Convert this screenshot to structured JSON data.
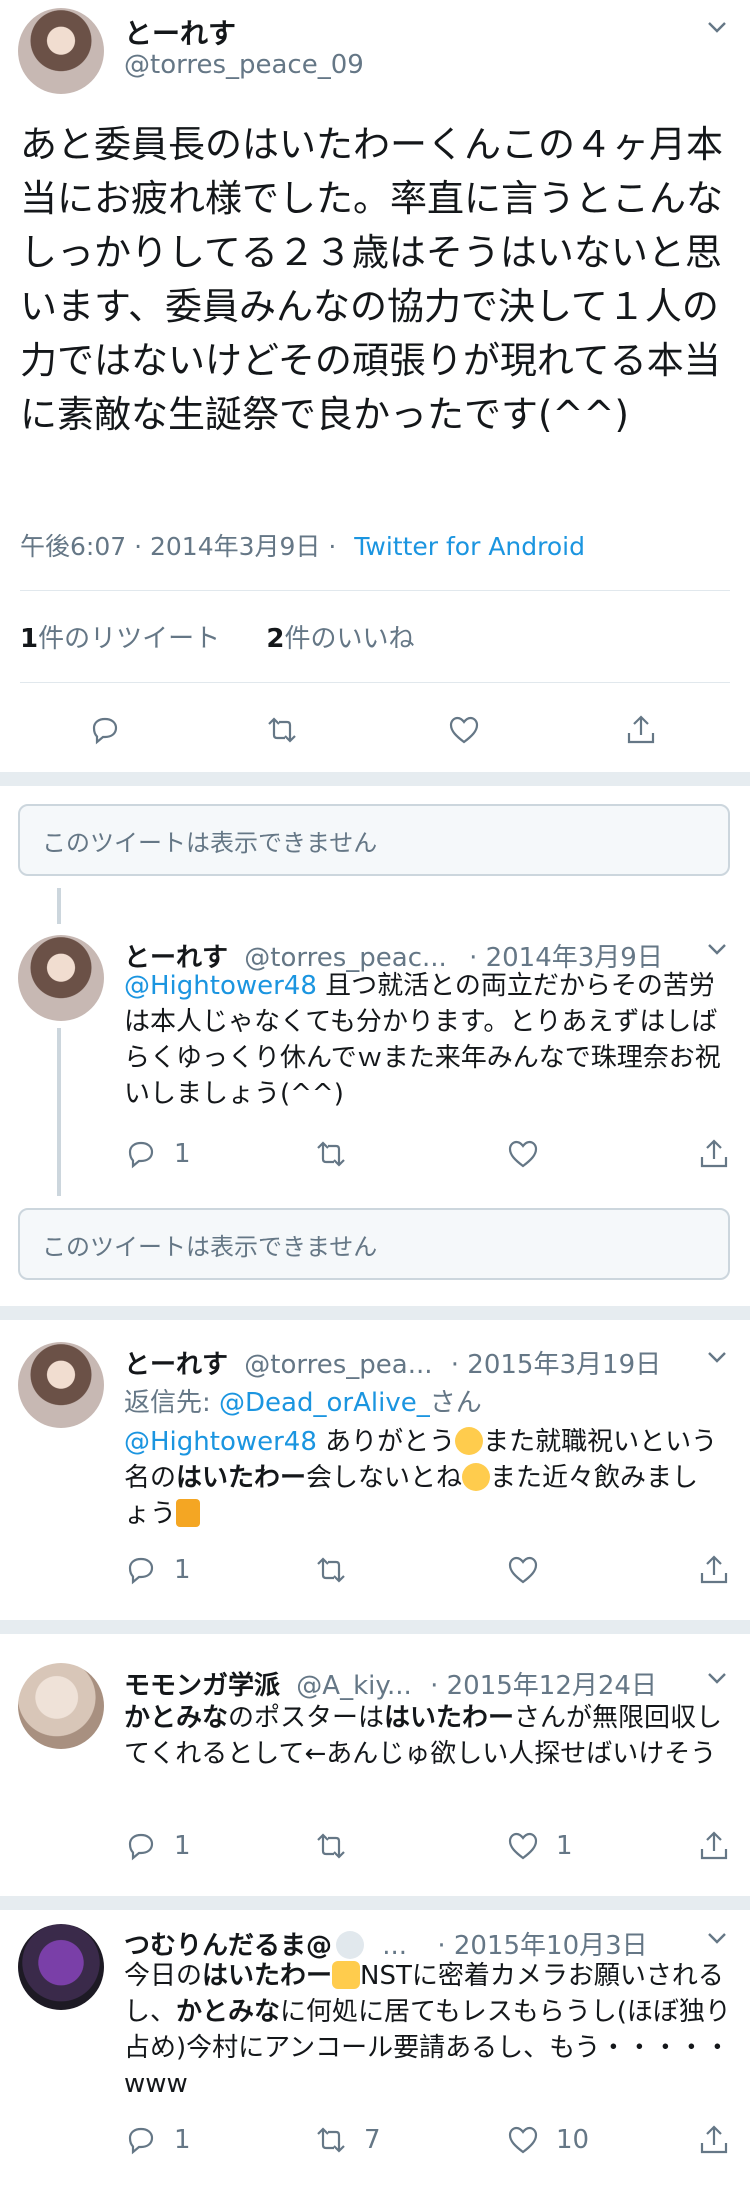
{
  "main": {
    "name": "とーれす",
    "handle": "@torres_peace_09",
    "text": "あと委員長のはいたわーくんこの４ヶ月本当にお疲れ様でした。率直に言うとこんなしっかりしてる２３歳はそうはいないと思います、委員みんなの協力で決して１人の力ではないけどその頑張りが現れてる本当に素敵な生誕祭で良かったです(^^)",
    "time": "午後6:07 · 2014年3月9日 ·",
    "source": "Twitter for Android",
    "retweets_num": "1",
    "retweets_label": "件のリツイート",
    "likes_num": "2",
    "likes_label": "件のいいね"
  },
  "unavailable_text": "このツイートは表示できません",
  "replies": [
    {
      "name": "とーれす",
      "handle": "@torres_peac...",
      "date": "· 2014年3月9日",
      "mention": "@Hightower48",
      "text": " 且つ就活との両立だからその苦労は本人じゃなくても分かります。とりあえずはしばらくゆっくり休んでｗまた来年みんなで珠理奈お祝いしましょう(^^)",
      "reply_count": "1",
      "retweet_count": "",
      "like_count": ""
    },
    {
      "name": "とーれす",
      "handle": "@torres_pea...",
      "date": "· 2015年3月19日",
      "reply_to_label": "返信先:",
      "reply_to_user": "@Dead_orAlive_",
      "reply_to_suffix": "さん",
      "mention": "@Hightower48",
      "text_1": " ありがとう",
      "text_2": "また就職祝いという名の",
      "bold": "はいたわー",
      "text_3": "会しないとね",
      "text_4": "また近々飲みましょう",
      "reply_count": "1",
      "retweet_count": "",
      "like_count": ""
    },
    {
      "name": "モモンガ学派",
      "handle": "@A_kiy...",
      "date": "· 2015年12月24日",
      "bold_1": "かとみな",
      "text_1": "のポスターは",
      "bold_2": "はいたわー",
      "text_2": "さんが無限回収してくれるとして←あんじゅ欲しい人探せばいけそう",
      "reply_count": "1",
      "retweet_count": "",
      "like_count": "1"
    },
    {
      "name": "つむりんだるま@",
      "name_suffix": "...",
      "date": "· 2015年10月3日",
      "text_1": "今日の",
      "bold_1": "はいたわー",
      "text_2": "NSTに密着カメラお願いされるし、",
      "bold_2": "かとみな",
      "text_3": "に何処に居てもレスもらうし(ほぼ独り占め)今村にアンコール要請あるし、もう・・・・・www",
      "reply_count": "1",
      "retweet_count": "7",
      "like_count": "10"
    }
  ],
  "icons": [
    "avatar",
    "chevron-down-icon",
    "reply-icon",
    "retweet-icon",
    "like-icon",
    "share-icon"
  ]
}
